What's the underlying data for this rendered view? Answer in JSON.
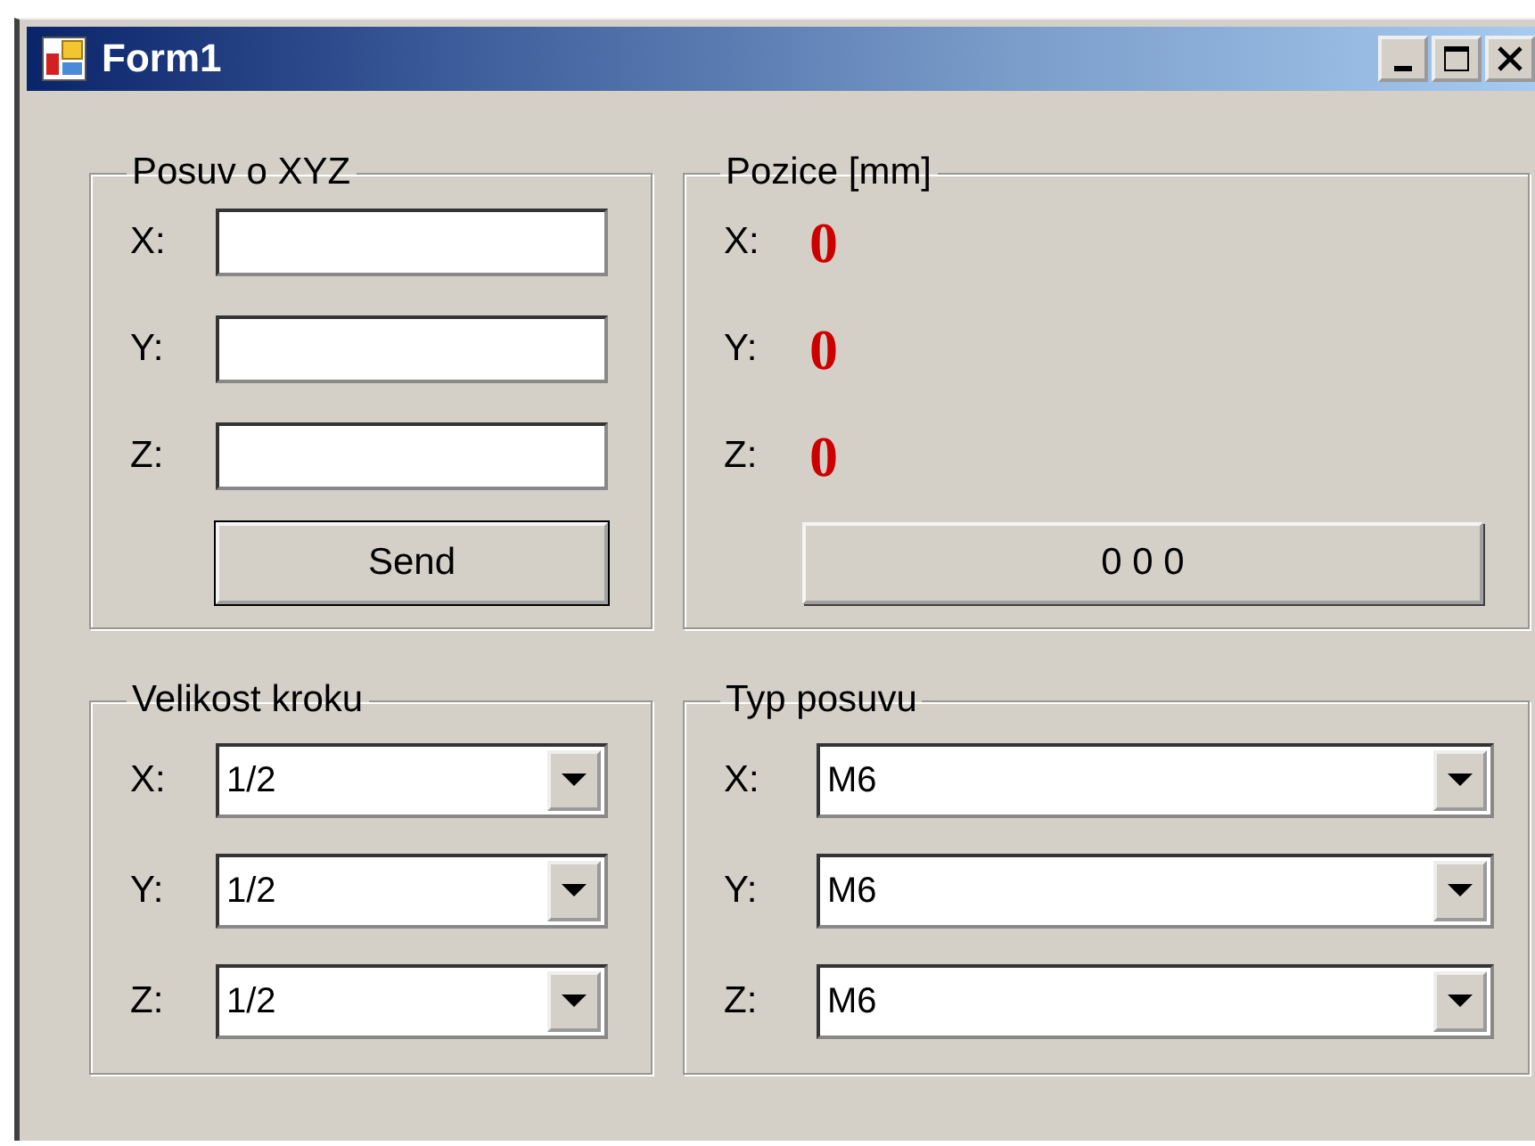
{
  "window": {
    "title": "Form1"
  },
  "posuv": {
    "title": "Posuv o XYZ",
    "fields": [
      {
        "label": "X:"
      },
      {
        "label": "Y:"
      },
      {
        "label": "Z:"
      }
    ],
    "button": "Send"
  },
  "pozice": {
    "title": "Pozice [mm]",
    "rows": [
      {
        "label": "X:",
        "value": "0"
      },
      {
        "label": "Y:",
        "value": "0"
      },
      {
        "label": "Z:",
        "value": "0"
      }
    ],
    "button": "0 0 0"
  },
  "velikost_kroku": {
    "title": "Velikost kroku",
    "rows": [
      {
        "label": "X:",
        "value": "1/2"
      },
      {
        "label": "Y:",
        "value": "1/2"
      },
      {
        "label": "Z:",
        "value": "1/2"
      }
    ]
  },
  "typ_posuvu": {
    "title": "Typ posuvu",
    "rows": [
      {
        "label": "X:",
        "value": "M6"
      },
      {
        "label": "Y:",
        "value": "M6"
      },
      {
        "label": "Z:",
        "value": "M6"
      }
    ]
  }
}
